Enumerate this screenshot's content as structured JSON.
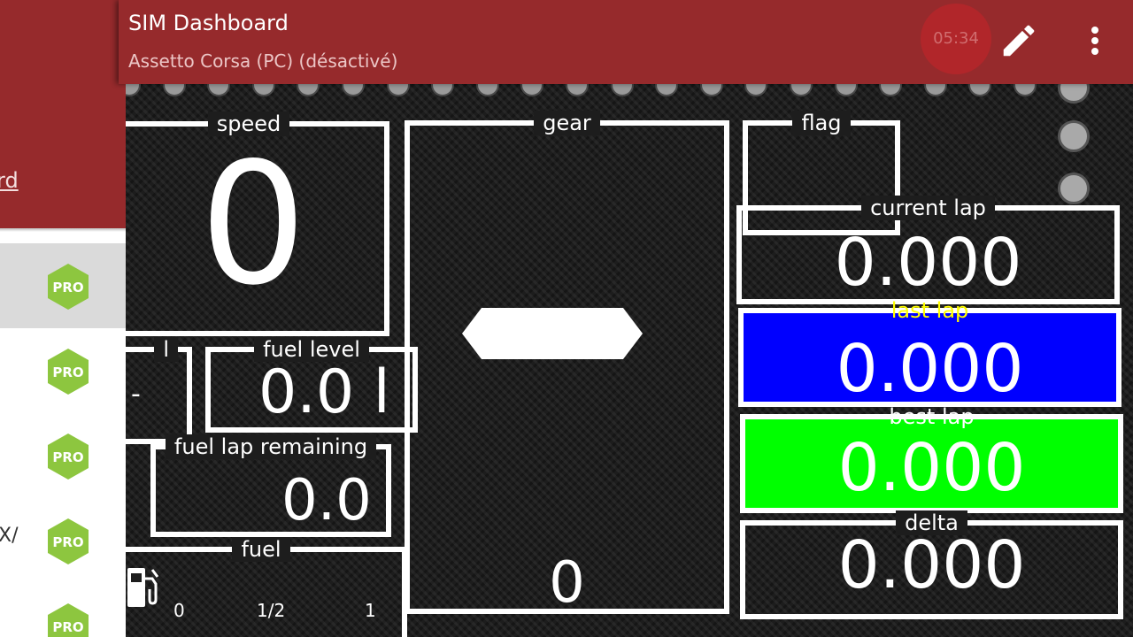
{
  "appbar": {
    "title": "SIM Dashboard",
    "subtitle": "Assetto Corsa (PC) (désactivé)",
    "timer": "05:34",
    "background": "#962a2c"
  },
  "drawer": {
    "header_link": "rd",
    "items": [
      {
        "text": "",
        "badge": "PRO",
        "selected": true
      },
      {
        "text": "",
        "badge": "PRO",
        "selected": false
      },
      {
        "text": "",
        "badge": "PRO",
        "selected": false
      },
      {
        "text": "X/",
        "badge": "PRO",
        "selected": false
      },
      {
        "text": "",
        "badge": "PRO",
        "selected": false
      }
    ],
    "badge_color": "#8dc63f"
  },
  "dashboard": {
    "speed": {
      "label": "speed",
      "value": "0"
    },
    "gear": {
      "label": "gear",
      "value": "0"
    },
    "flag": {
      "label": "flag"
    },
    "fuel_partial": {
      "label": "l",
      "value": "-"
    },
    "fuel_level": {
      "label": "fuel level",
      "value": "0.0 l"
    },
    "fuel_lap_remaining": {
      "label": "fuel lap remaining",
      "value": "0.0"
    },
    "fuel": {
      "label": "fuel",
      "scale_min": "0",
      "scale_mid": "1/2",
      "scale_max": "1"
    },
    "current_lap": {
      "label": "current lap",
      "value": "0.000"
    },
    "last_lap": {
      "label": "last lap",
      "value": "0.000",
      "color": "#0000ff",
      "label_color": "#ffff00"
    },
    "best_lap": {
      "label": "best lap",
      "value": "0.000",
      "color": "#00ff00"
    },
    "delta": {
      "label": "delta",
      "value": "0.000"
    }
  }
}
